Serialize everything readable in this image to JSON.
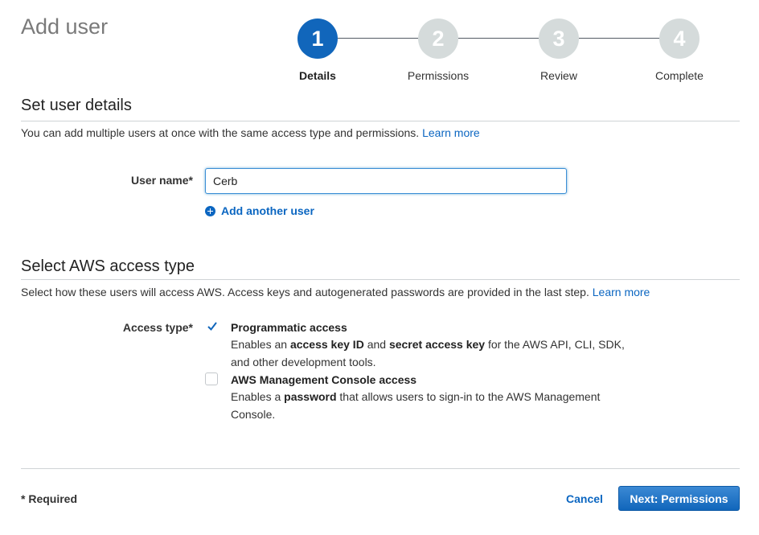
{
  "page_title": "Add user",
  "steps": [
    {
      "number": "1",
      "label": "Details",
      "active": true
    },
    {
      "number": "2",
      "label": "Permissions",
      "active": false
    },
    {
      "number": "3",
      "label": "Review",
      "active": false
    },
    {
      "number": "4",
      "label": "Complete",
      "active": false
    }
  ],
  "user_details": {
    "title": "Set user details",
    "description": "You can add multiple users at once with the same access type and permissions.",
    "learn_more": "Learn more",
    "user_name_label": "User name*",
    "user_name_value": "Cerb",
    "add_another_user": "Add another user"
  },
  "access_type": {
    "title": "Select AWS access type",
    "description": "Select how these users will access AWS. Access keys and autogenerated passwords are provided in the last step.",
    "learn_more": "Learn more",
    "label": "Access type*",
    "options": [
      {
        "title": "Programmatic access",
        "checked": true,
        "desc_prefix": "Enables an ",
        "desc_bold1": "access key ID",
        "desc_mid": " and ",
        "desc_bold2": "secret access key",
        "desc_suffix": " for the AWS API, CLI, SDK, and other development tools."
      },
      {
        "title": "AWS Management Console access",
        "checked": false,
        "desc_prefix": "Enables a ",
        "desc_bold1": "password",
        "desc_suffix": " that allows users to sign-in to the AWS Management Console."
      }
    ]
  },
  "footer": {
    "required_note": "* Required",
    "cancel_label": "Cancel",
    "next_label": "Next: Permissions"
  },
  "colors": {
    "accent": "#1166bb",
    "link": "#0b66c1",
    "inactive_step": "#d5dbdb"
  }
}
